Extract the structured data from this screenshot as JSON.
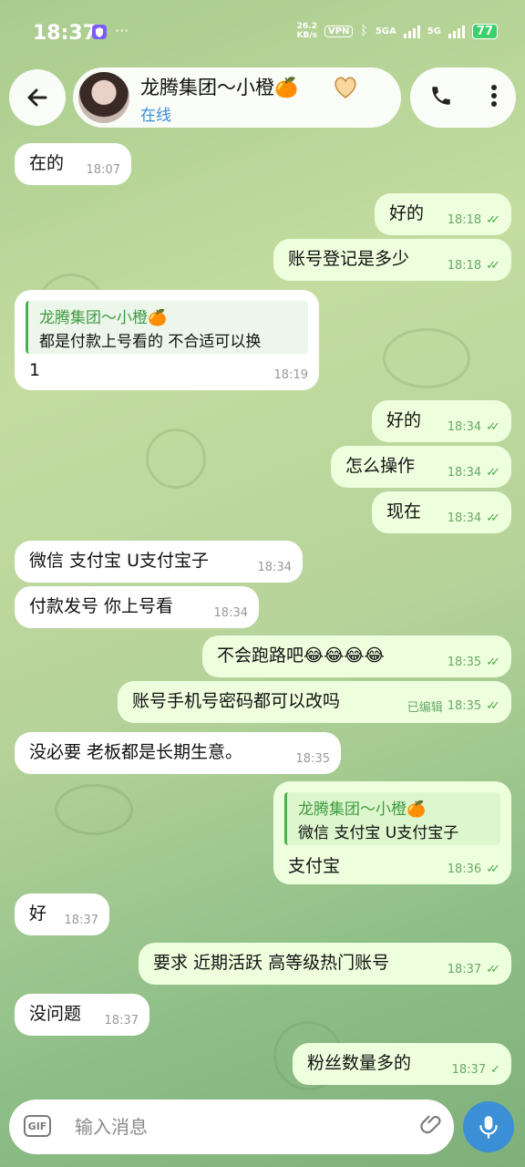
{
  "status_bar": {
    "time": "18:37",
    "net_speed_value": "26.2",
    "net_speed_unit": "KB/s",
    "vpn": "VPN",
    "sim1": "5GA",
    "sim2": "5G",
    "battery": "77"
  },
  "header": {
    "chat_title": "龙腾集团～小橙🍊",
    "chat_status": "在线"
  },
  "messages": [
    {
      "text": "在的",
      "time": "18:07"
    },
    {
      "text": "好的",
      "time": "18:18"
    },
    {
      "text": "账号登记是多少",
      "time": "18:18"
    },
    {
      "reply_name": "龙腾集团～小橙🍊",
      "reply_text": "都是付款上号看的 不合适可以换",
      "text": "1",
      "time": "18:19"
    },
    {
      "text": "好的",
      "time": "18:34"
    },
    {
      "text": "怎么操作",
      "time": "18:34"
    },
    {
      "text": "现在",
      "time": "18:34"
    },
    {
      "text": "微信 支付宝 U支付宝子",
      "time": "18:34"
    },
    {
      "text": "付款发号 你上号看",
      "time": "18:34"
    },
    {
      "text": "不会跑路吧😂😂😂😂",
      "time": "18:35"
    },
    {
      "text": "账号手机号密码都可以改吗",
      "edited": "已编辑",
      "time": "18:35"
    },
    {
      "text": "没必要 老板都是长期生意。",
      "time": "18:35"
    },
    {
      "reply_name": "龙腾集团～小橙🍊",
      "reply_text": "微信 支付宝 U支付宝子",
      "text": "支付宝",
      "time": "18:36"
    },
    {
      "text": "好",
      "time": "18:37"
    },
    {
      "text": "要求 近期活跃 高等级热门账号",
      "time": "18:37"
    },
    {
      "text": "没问题",
      "time": "18:37"
    },
    {
      "text": "粉丝数量多的",
      "time": "18:37"
    }
  ],
  "input": {
    "gif_label": "GIF",
    "placeholder": "输入消息"
  },
  "icons": {
    "back": "arrow-left-icon",
    "call": "phone-icon",
    "more": "more-vertical-icon",
    "attach": "paperclip-icon",
    "mic": "microphone-icon",
    "read": "double-check-icon",
    "sent": "check-icon"
  },
  "colors": {
    "incoming_bubble": "#ffffff",
    "outgoing_bubble": "#eeffde",
    "accent": "#3a8fd6",
    "reply_name": "#3f9b3f"
  }
}
